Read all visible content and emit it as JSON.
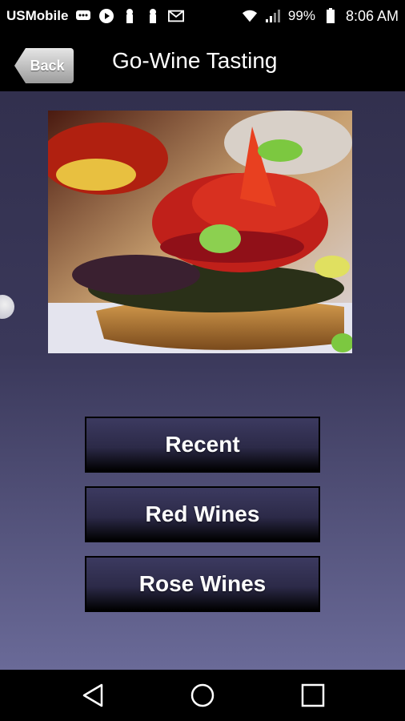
{
  "status_bar": {
    "carrier": "USMobile",
    "battery": "99%",
    "time": "8:06 AM",
    "icons": [
      "message-icon",
      "play-icon",
      "keyhole-icon",
      "keyhole-icon",
      "gmail-icon",
      "wifi-icon",
      "signal-icon",
      "battery-icon"
    ]
  },
  "header": {
    "back_label": "Back",
    "title": "Go-Wine Tasting"
  },
  "main": {
    "image_icon": "food-photo",
    "buttons": [
      {
        "label": "Recent"
      },
      {
        "label": "Red Wines"
      },
      {
        "label": "Rose Wines"
      }
    ]
  },
  "nav": {
    "icons": [
      "back-triangle-icon",
      "home-circle-icon",
      "recents-square-icon"
    ]
  },
  "colors": {
    "background_top": "#32304e",
    "background_bottom": "#6a6a98",
    "button_top": "#3c3a60",
    "button_bottom": "#000000"
  }
}
